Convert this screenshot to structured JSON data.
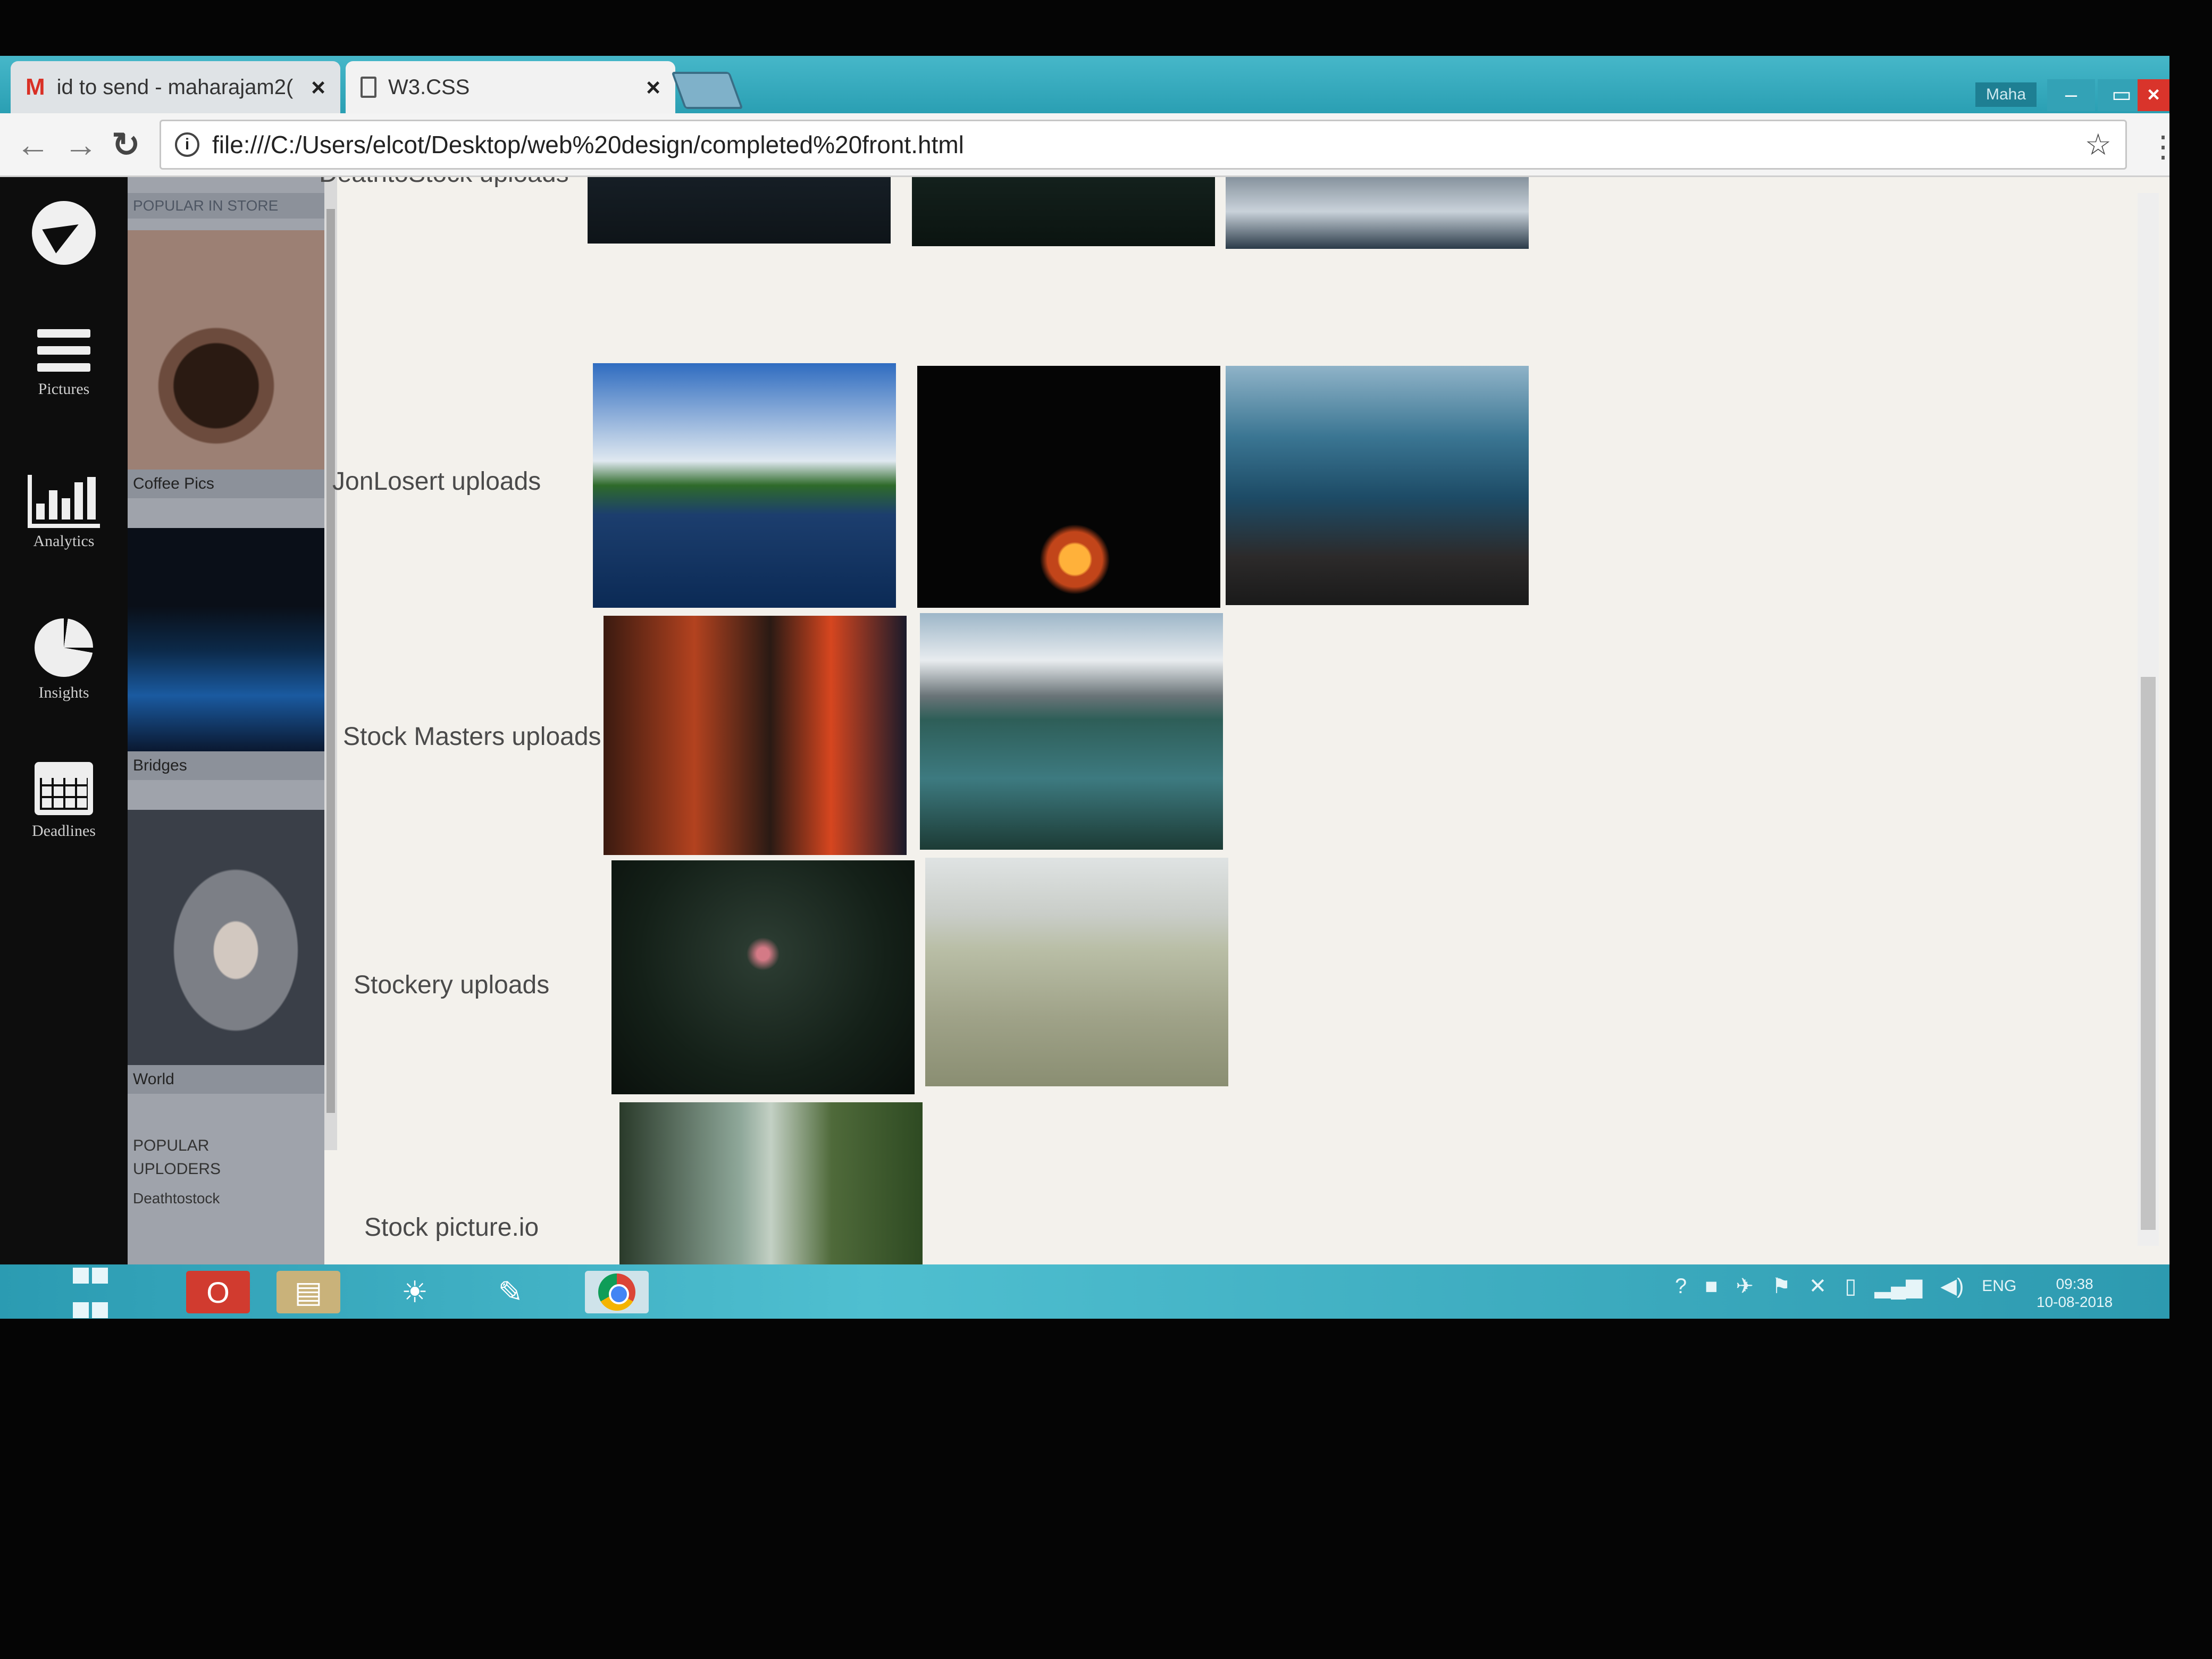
{
  "browser": {
    "tabs": [
      {
        "label": "id to send - maharajam2(",
        "icon": "gmail-icon",
        "active": false
      },
      {
        "label": "W3.CSS",
        "icon": "document-icon",
        "active": true
      }
    ],
    "url": "file:///C:/Users/elcot/Desktop/web%20design/completed%20front.html",
    "user": "Maha"
  },
  "sidebar": {
    "items": [
      {
        "icon": "telegram-icon",
        "label": ""
      },
      {
        "icon": "hamburger-icon",
        "label": "Pictures"
      },
      {
        "icon": "bar-chart-icon",
        "label": "Analytics"
      },
      {
        "icon": "pie-chart-icon",
        "label": "Insights"
      },
      {
        "icon": "calendar-icon",
        "label": "Deadlines"
      }
    ]
  },
  "store": {
    "heading": "POPULAR IN STORE",
    "cards": [
      {
        "label": "Coffee Pics"
      },
      {
        "label": "Bridges"
      },
      {
        "label": "World"
      }
    ],
    "popular_uploaders": "POPULAR UPLODERS",
    "uploader": "Deathtostock"
  },
  "main": {
    "rows": [
      {
        "name": "DeathtoStock uploads",
        "images": 3
      },
      {
        "name": "JonLosert uploads",
        "images": 3
      },
      {
        "name": "Stock Masters uploads",
        "images": 2
      },
      {
        "name": "Stockery uploads",
        "images": 2
      },
      {
        "name": "Stock picture.io",
        "images": 1
      }
    ]
  },
  "taskbar": {
    "apps": [
      "start-icon",
      "opera-icon",
      "file-explorer-icon",
      "paint-icon",
      "messenger-icon",
      "chrome-icon"
    ],
    "language": "ENG",
    "time": "09:38",
    "date": "10-08-2018"
  },
  "colors": {
    "titlebar": "#2a9fb3",
    "sidebar_bg": "#0d0d0d",
    "store_bg": "#9fa3ab",
    "close_red": "#d9342b"
  }
}
